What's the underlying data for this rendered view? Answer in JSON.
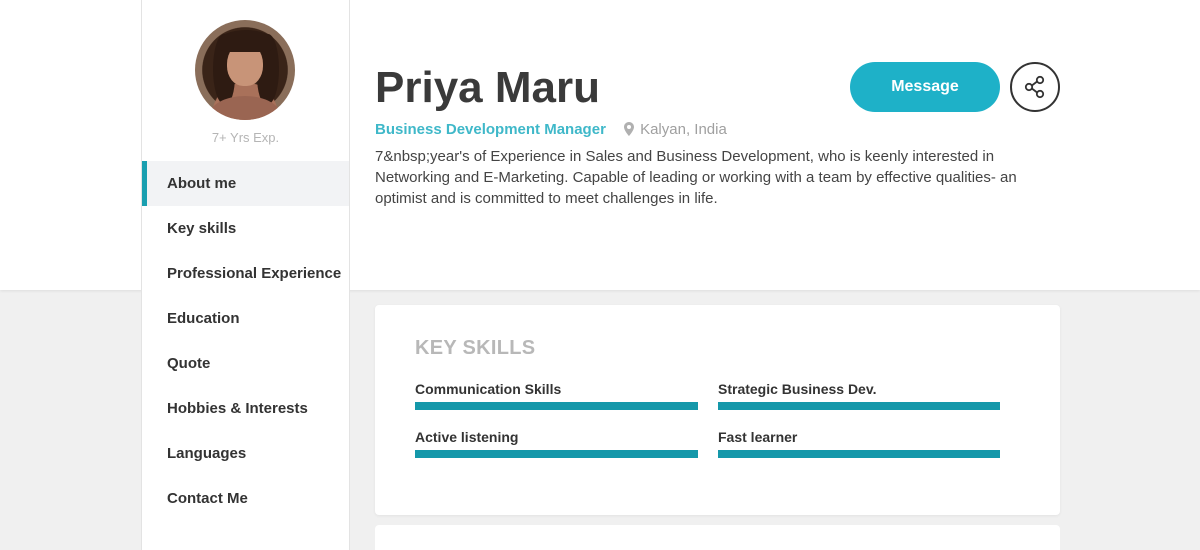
{
  "profile": {
    "name": "Priya Maru",
    "experience": "7+ Yrs Exp.",
    "role": "Business Development Manager",
    "location": "Kalyan, India",
    "bio": "7&nbsp;year's of Experience in Sales and Business Development, who is keenly interested in Networking and E-Marketing. Capable of leading or working with a team by effective qualities- an optimist and is committed to meet challenges in life."
  },
  "actions": {
    "message_label": "Message",
    "share_icon": "share-icon"
  },
  "nav": {
    "items": [
      {
        "label": "About me",
        "active": true
      },
      {
        "label": "Key skills",
        "active": false
      },
      {
        "label": "Professional Experience",
        "active": false
      },
      {
        "label": "Education",
        "active": false
      },
      {
        "label": "Quote",
        "active": false
      },
      {
        "label": "Hobbies & Interests",
        "active": false
      },
      {
        "label": "Languages",
        "active": false
      },
      {
        "label": "Contact Me",
        "active": false
      }
    ]
  },
  "skills": {
    "title": "KEY SKILLS",
    "items": [
      {
        "name": "Communication Skills",
        "level": 1.0
      },
      {
        "name": "Strategic Business Dev.",
        "level": 1.0
      },
      {
        "name": "Active listening",
        "level": 1.0
      },
      {
        "name": "Fast learner",
        "level": 1.0
      }
    ]
  },
  "colors": {
    "accent": "#1eb1c8",
    "role_text": "#3fb8c9",
    "skill_bar": "#1598aa"
  }
}
